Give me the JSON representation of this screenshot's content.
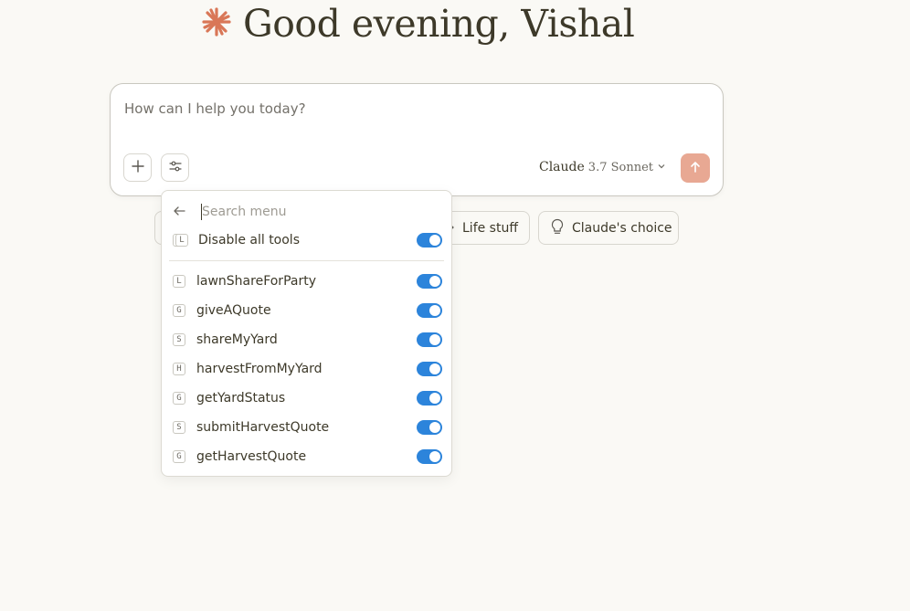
{
  "greeting": {
    "text": "Good evening, Vishal"
  },
  "composer": {
    "placeholder": "How can I help you today?",
    "model_name": "Claude",
    "model_version": "3.7 Sonnet"
  },
  "chips": [
    {
      "label": "Life stuff",
      "icon": "arrow-icon"
    },
    {
      "label": "Claude's choice",
      "icon": "lightbulb-icon"
    }
  ],
  "tools_menu": {
    "search_placeholder": "Search menu",
    "disable_all": {
      "badge": "L",
      "label": "Disable all tools",
      "enabled": true
    },
    "tools": [
      {
        "badge": "L",
        "label": "lawnShareForParty",
        "enabled": true
      },
      {
        "badge": "G",
        "label": "giveAQuote",
        "enabled": true
      },
      {
        "badge": "S",
        "label": "shareMyYard",
        "enabled": true
      },
      {
        "badge": "H",
        "label": "harvestFromMyYard",
        "enabled": true
      },
      {
        "badge": "G",
        "label": "getYardStatus",
        "enabled": true
      },
      {
        "badge": "S",
        "label": "submitHarvestQuote",
        "enabled": true
      },
      {
        "badge": "G",
        "label": "getHarvestQuote",
        "enabled": true
      }
    ]
  },
  "colors": {
    "accent": "#d97757",
    "toggle_on": "#2c84db",
    "send_button": "#e8a893",
    "background": "#faf9f5"
  }
}
